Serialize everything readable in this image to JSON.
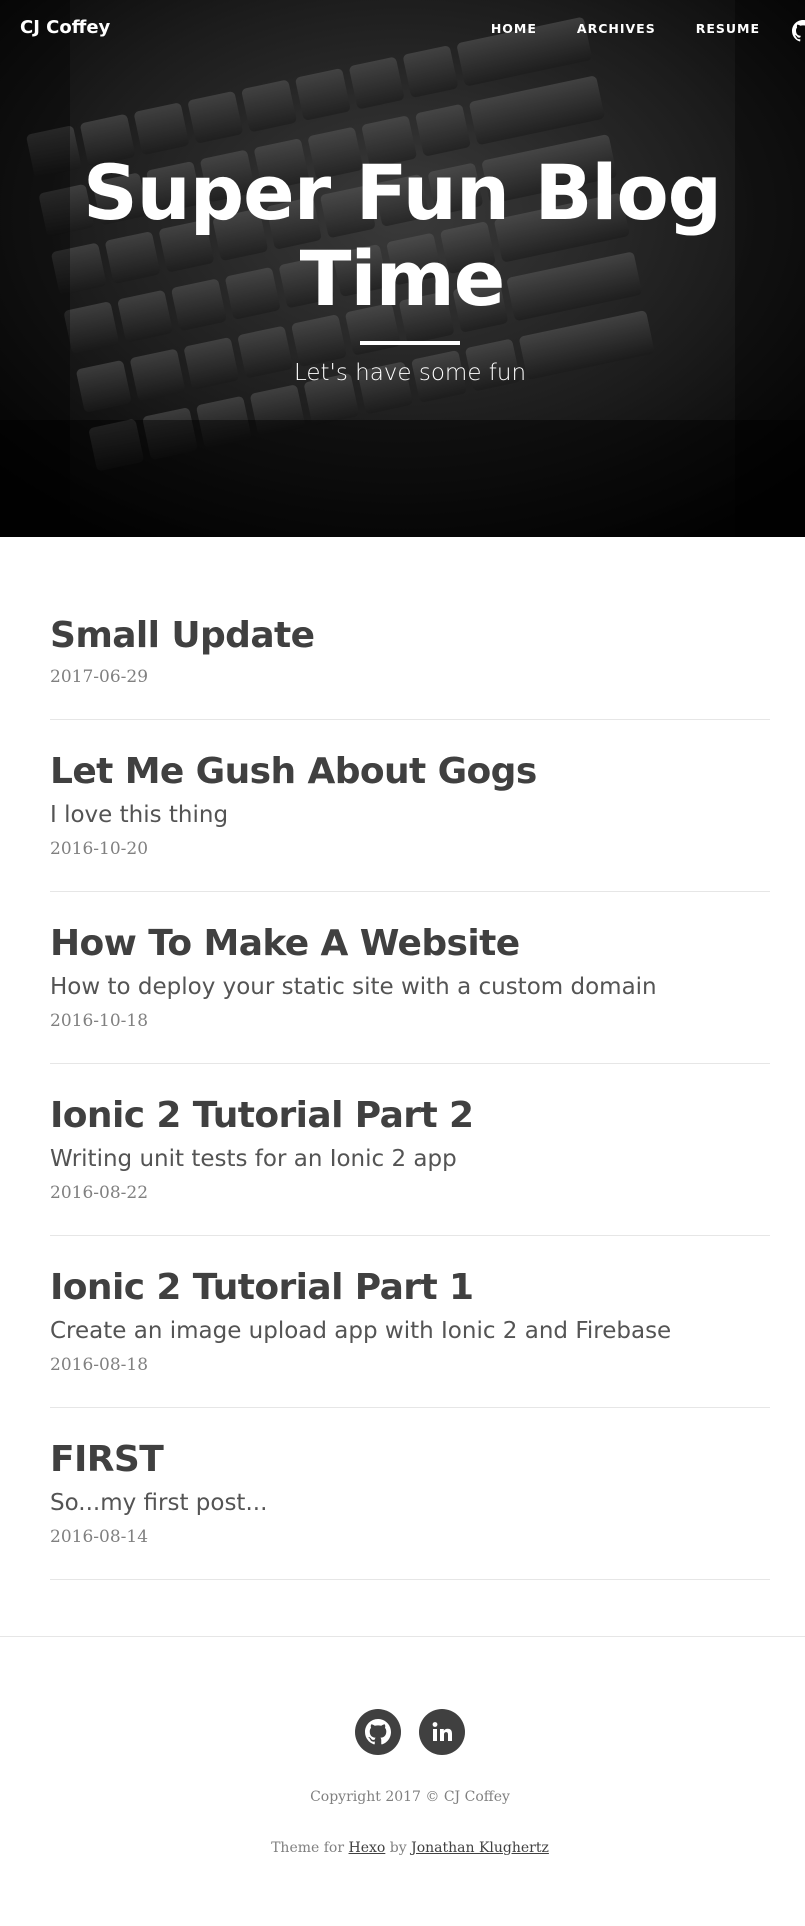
{
  "nav": {
    "brand": "CJ Coffey",
    "links": [
      {
        "label": "HOME"
      },
      {
        "label": "ARCHIVES"
      },
      {
        "label": "RESUME"
      }
    ],
    "github_icon": "github-icon"
  },
  "hero": {
    "title": "Super Fun Blog Time",
    "subtitle": "Let's have some fun",
    "background": "keyboard-photo"
  },
  "posts": [
    {
      "title": "Small Update",
      "subtitle": "",
      "date": "2017-06-29"
    },
    {
      "title": "Let Me Gush About Gogs",
      "subtitle": "I love this thing",
      "date": "2016-10-20"
    },
    {
      "title": "How To Make A Website",
      "subtitle": "How to deploy your static site with a custom domain",
      "date": "2016-10-18"
    },
    {
      "title": "Ionic 2 Tutorial Part 2",
      "subtitle": "Writing unit tests for an Ionic 2 app",
      "date": "2016-08-22"
    },
    {
      "title": "Ionic 2 Tutorial Part 1",
      "subtitle": "Create an image upload app with Ionic 2 and Firebase",
      "date": "2016-08-18"
    },
    {
      "title": "FIRST",
      "subtitle": "So...my first post...",
      "date": "2016-08-14"
    }
  ],
  "footer": {
    "social": [
      {
        "icon": "github-icon"
      },
      {
        "icon": "linkedin-icon"
      }
    ],
    "copyright": "Copyright 2017 © CJ Coffey",
    "theme_prefix": "Theme for",
    "theme_link": "Hexo",
    "by": "by",
    "author_link": "Jonathan Klughertz"
  },
  "colors": {
    "text": "#404040",
    "muted": "#808080",
    "divider": "#e6e6e6",
    "hero_text": "#ffffff"
  }
}
